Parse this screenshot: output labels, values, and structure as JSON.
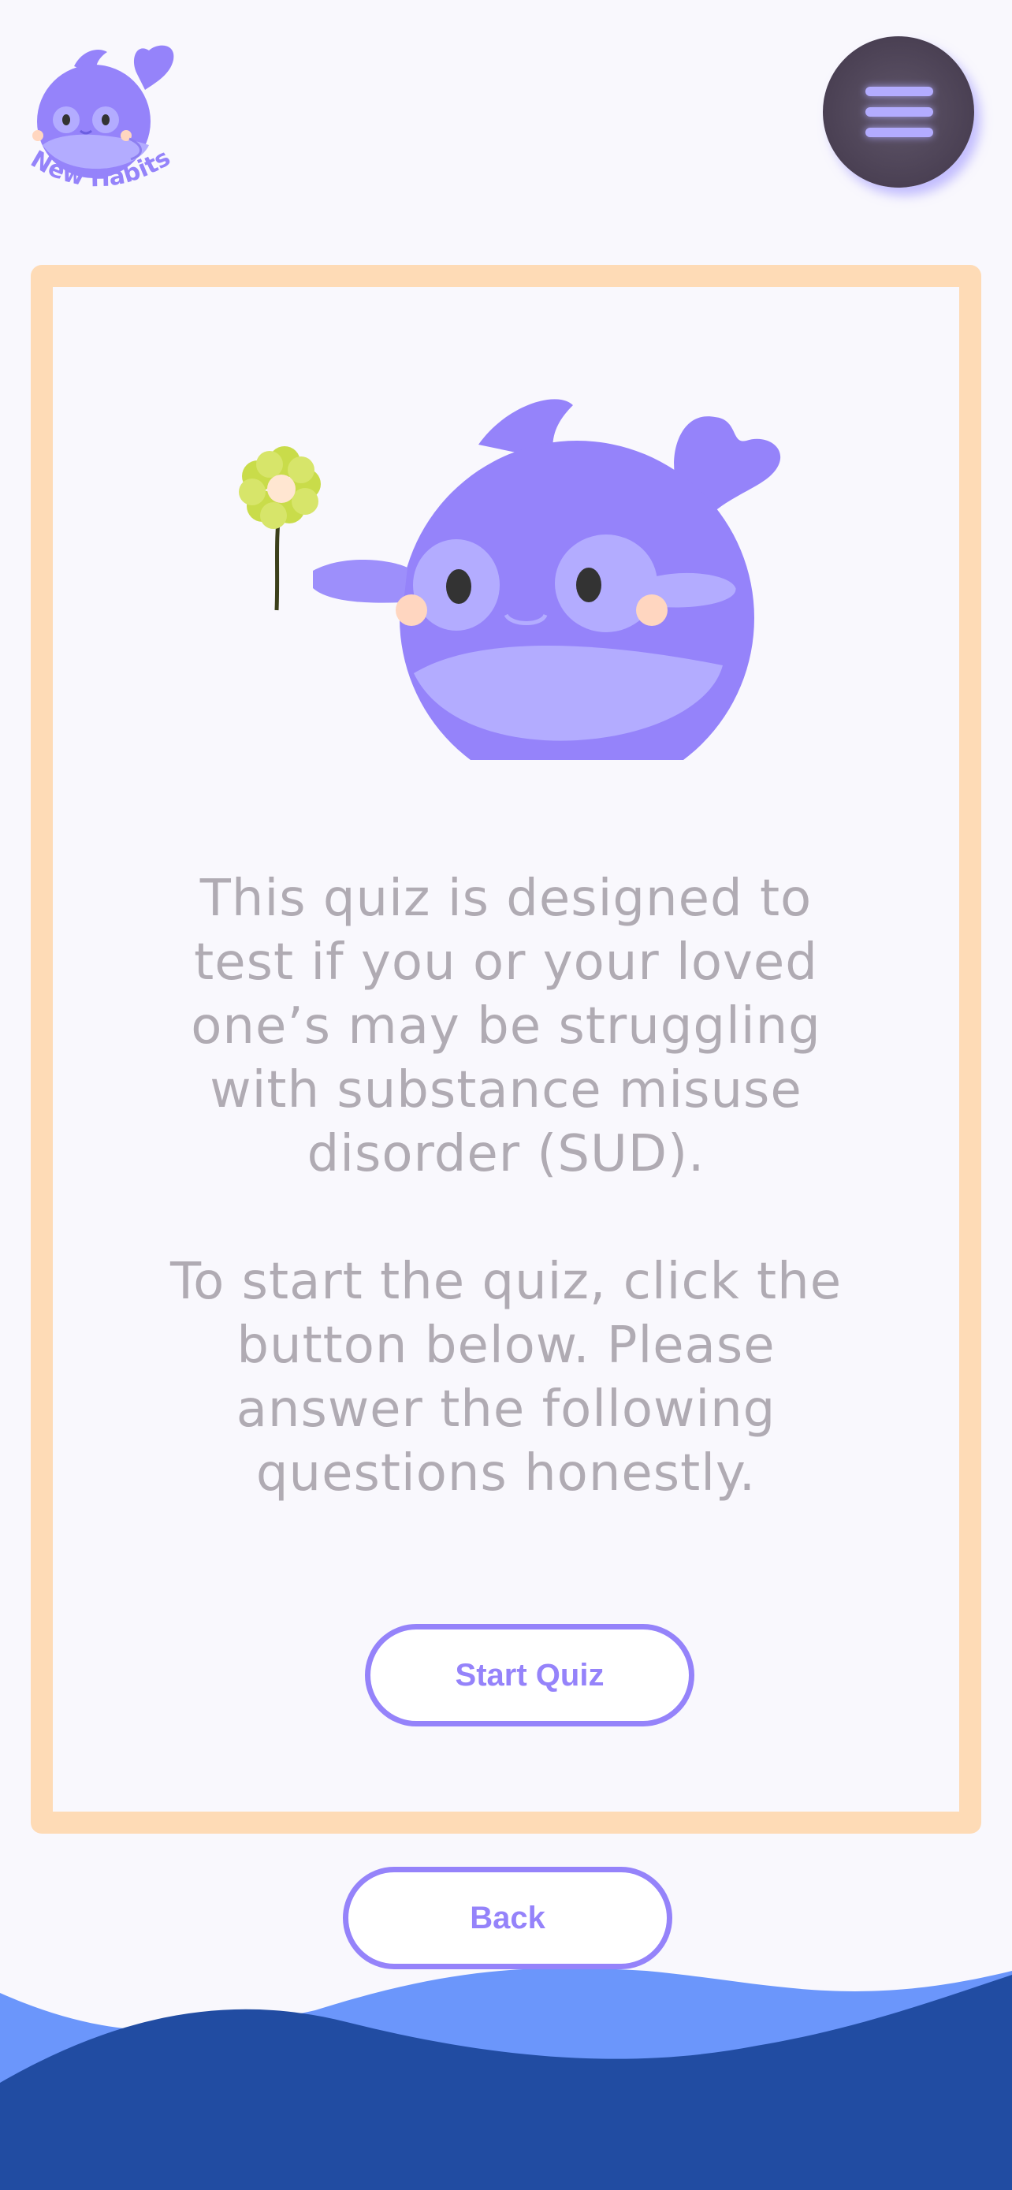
{
  "brand": {
    "name": "New Habits"
  },
  "header": {
    "menu_icon": "hamburger-menu-icon"
  },
  "hero": {
    "mascot": "whale-mascot-holding-flower"
  },
  "intro": {
    "paragraph_1_lines": [
      "This quiz is designed to",
      "test if you or your loved",
      "one’s may be struggling",
      "with substance misuse",
      "disorder (SUD)."
    ],
    "paragraph_2_lines": [
      "To start the quiz, click the",
      "button below. Please",
      "answer the following",
      "questions honestly."
    ]
  },
  "buttons": {
    "start_label": "Start Quiz",
    "back_label": "Back"
  },
  "colors": {
    "background": "#f9f8fd",
    "card_border": "#fedbb6",
    "accent": "#9583fa",
    "text_muted": "#b0abb3",
    "menu_button": "#4a4053",
    "wave_light": "#6b96fb",
    "wave_dark": "#214ca2"
  }
}
